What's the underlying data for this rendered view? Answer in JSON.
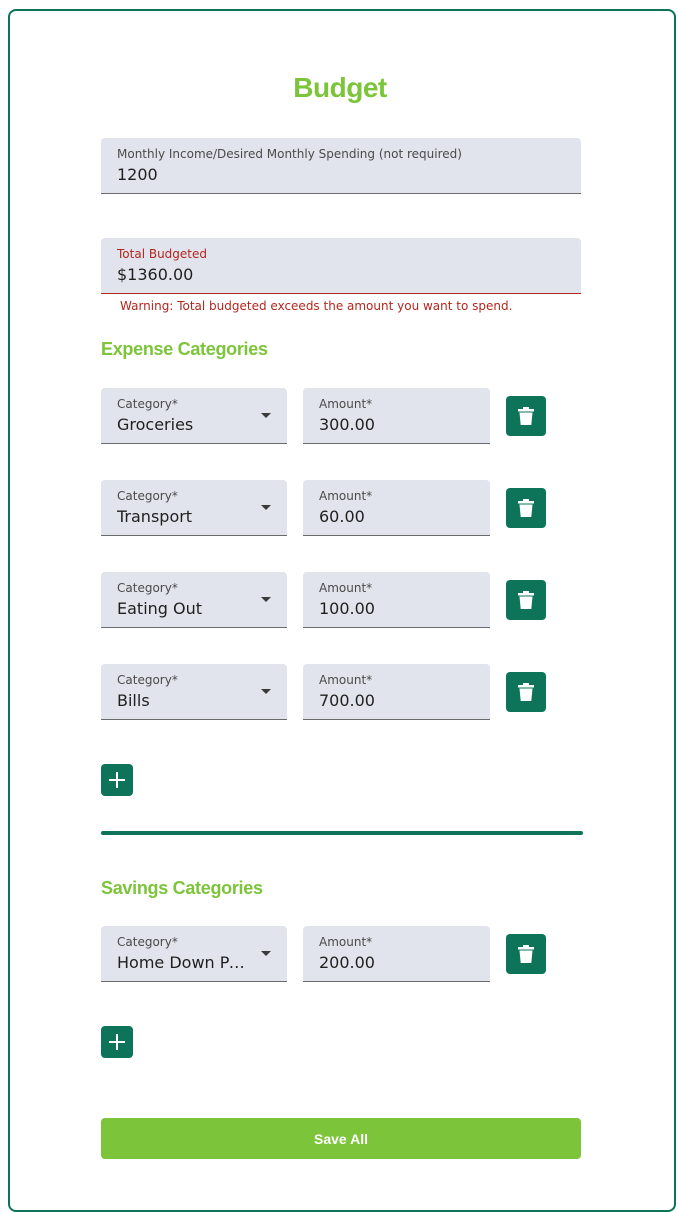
{
  "page": {
    "title": "Budget"
  },
  "income": {
    "label": "Monthly Income/Desired Monthly Spending (not required)",
    "value": "1200"
  },
  "total": {
    "label": "Total Budgeted",
    "value": "$1360.00",
    "warning": "Warning: Total budgeted exceeds the amount you want to spend."
  },
  "expenses": {
    "title": "Expense Categories",
    "category_label": "Category*",
    "amount_label": "Amount*",
    "rows": [
      {
        "category": "Groceries",
        "amount": "300.00"
      },
      {
        "category": "Transport",
        "amount": "60.00"
      },
      {
        "category": "Eating Out",
        "amount": "100.00"
      },
      {
        "category": "Bills",
        "amount": "700.00"
      }
    ]
  },
  "savings": {
    "title": "Savings Categories",
    "category_label": "Category*",
    "amount_label": "Amount*",
    "rows": [
      {
        "category": "Home Down Payment",
        "amount": "200.00"
      }
    ]
  },
  "actions": {
    "save_label": "Save All"
  },
  "colors": {
    "accent_green": "#7cc43a",
    "dark_green": "#0d7459",
    "error_red": "#b3261e",
    "field_bg": "#e1e4ec"
  },
  "icons": {
    "delete": "trash-icon",
    "add": "plus-icon",
    "dropdown": "chevron-down-icon"
  }
}
